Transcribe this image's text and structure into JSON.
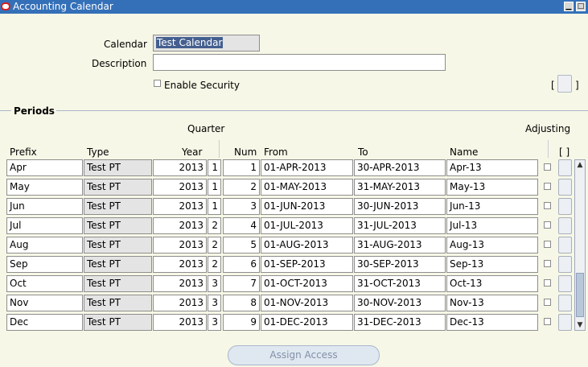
{
  "window": {
    "title": "Accounting Calendar"
  },
  "header": {
    "calendar_label": "Calendar",
    "calendar_value": "Test Calendar",
    "description_label": "Description",
    "description_value": "",
    "enable_security_label": "Enable Security",
    "enable_security_checked": false,
    "bracket_left": "[",
    "bracket_right": "]"
  },
  "periods": {
    "section_label": "Periods",
    "quarter_label": "Quarter",
    "adjusting_label": "Adjusting",
    "columns": {
      "prefix": "Prefix",
      "type": "Type",
      "year": "Year",
      "num": "Num",
      "from": "From",
      "to": "To",
      "name": "Name",
      "flex": "[ ]"
    },
    "rows": [
      {
        "prefix": "Apr",
        "type": "Test PT",
        "year": "2013",
        "quarter": "1",
        "num": "1",
        "from": "01-APR-2013",
        "to": "30-APR-2013",
        "name": "Apr-13"
      },
      {
        "prefix": "May",
        "type": "Test PT",
        "year": "2013",
        "quarter": "1",
        "num": "2",
        "from": "01-MAY-2013",
        "to": "31-MAY-2013",
        "name": "May-13"
      },
      {
        "prefix": "Jun",
        "type": "Test PT",
        "year": "2013",
        "quarter": "1",
        "num": "3",
        "from": "01-JUN-2013",
        "to": "30-JUN-2013",
        "name": "Jun-13"
      },
      {
        "prefix": "Jul",
        "type": "Test PT",
        "year": "2013",
        "quarter": "2",
        "num": "4",
        "from": "01-JUL-2013",
        "to": "31-JUL-2013",
        "name": "Jul-13"
      },
      {
        "prefix": "Aug",
        "type": "Test PT",
        "year": "2013",
        "quarter": "2",
        "num": "5",
        "from": "01-AUG-2013",
        "to": "31-AUG-2013",
        "name": "Aug-13"
      },
      {
        "prefix": "Sep",
        "type": "Test PT",
        "year": "2013",
        "quarter": "2",
        "num": "6",
        "from": "01-SEP-2013",
        "to": "30-SEP-2013",
        "name": "Sep-13"
      },
      {
        "prefix": "Oct",
        "type": "Test PT",
        "year": "2013",
        "quarter": "3",
        "num": "7",
        "from": "01-OCT-2013",
        "to": "31-OCT-2013",
        "name": "Oct-13"
      },
      {
        "prefix": "Nov",
        "type": "Test PT",
        "year": "2013",
        "quarter": "3",
        "num": "8",
        "from": "01-NOV-2013",
        "to": "30-NOV-2013",
        "name": "Nov-13"
      },
      {
        "prefix": "Dec",
        "type": "Test PT",
        "year": "2013",
        "quarter": "3",
        "num": "9",
        "from": "01-DEC-2013",
        "to": "31-DEC-2013",
        "name": "Dec-13"
      }
    ]
  },
  "footer": {
    "assign_access_label": "Assign Access"
  },
  "colors": {
    "titlebar": "#3470b8",
    "background": "#f7f7e7",
    "selection": "#445f8f"
  },
  "icons": {
    "app": "oracle-logo-icon",
    "minimize": "minimize-icon",
    "maximize": "maximize-icon",
    "scroll_up": "scroll-up-icon",
    "scroll_down": "scroll-down-icon"
  }
}
